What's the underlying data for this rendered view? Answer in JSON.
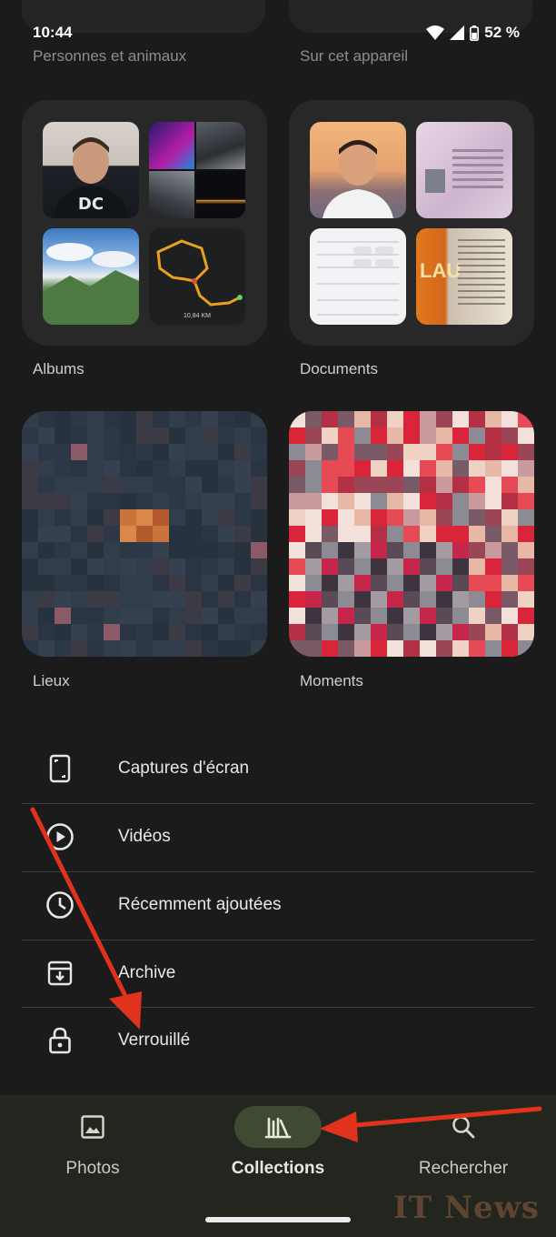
{
  "status_bar": {
    "time": "10:44",
    "battery": "52 %"
  },
  "top_sections": [
    {
      "label": "Personnes et animaux"
    },
    {
      "label": "Sur cet appareil"
    }
  ],
  "collections": {
    "albums": {
      "label": "Albums",
      "map_distance": "10,84 KM"
    },
    "documents": {
      "label": "Documents"
    },
    "places": {
      "label": "Lieux"
    },
    "moments": {
      "label": "Moments"
    }
  },
  "list_items": [
    {
      "label": "Captures d'écran",
      "icon": "screenshot-icon"
    },
    {
      "label": "Vidéos",
      "icon": "play-circle-icon"
    },
    {
      "label": "Récemment ajoutées",
      "icon": "clock-icon"
    },
    {
      "label": "Archive",
      "icon": "archive-icon"
    },
    {
      "label": "Verrouillé",
      "icon": "lock-icon"
    }
  ],
  "bottom_nav": [
    {
      "label": "Photos",
      "icon": "image-icon",
      "active": false
    },
    {
      "label": "Collections",
      "icon": "collections-icon",
      "active": true
    },
    {
      "label": "Rechercher",
      "icon": "search-icon",
      "active": false
    }
  ],
  "watermark": "IT News",
  "colors": {
    "background": "#1b1b1b",
    "nav_background": "#23261e",
    "nav_active_pill": "#3e4a34",
    "annotation_arrow": "#e0321c"
  }
}
